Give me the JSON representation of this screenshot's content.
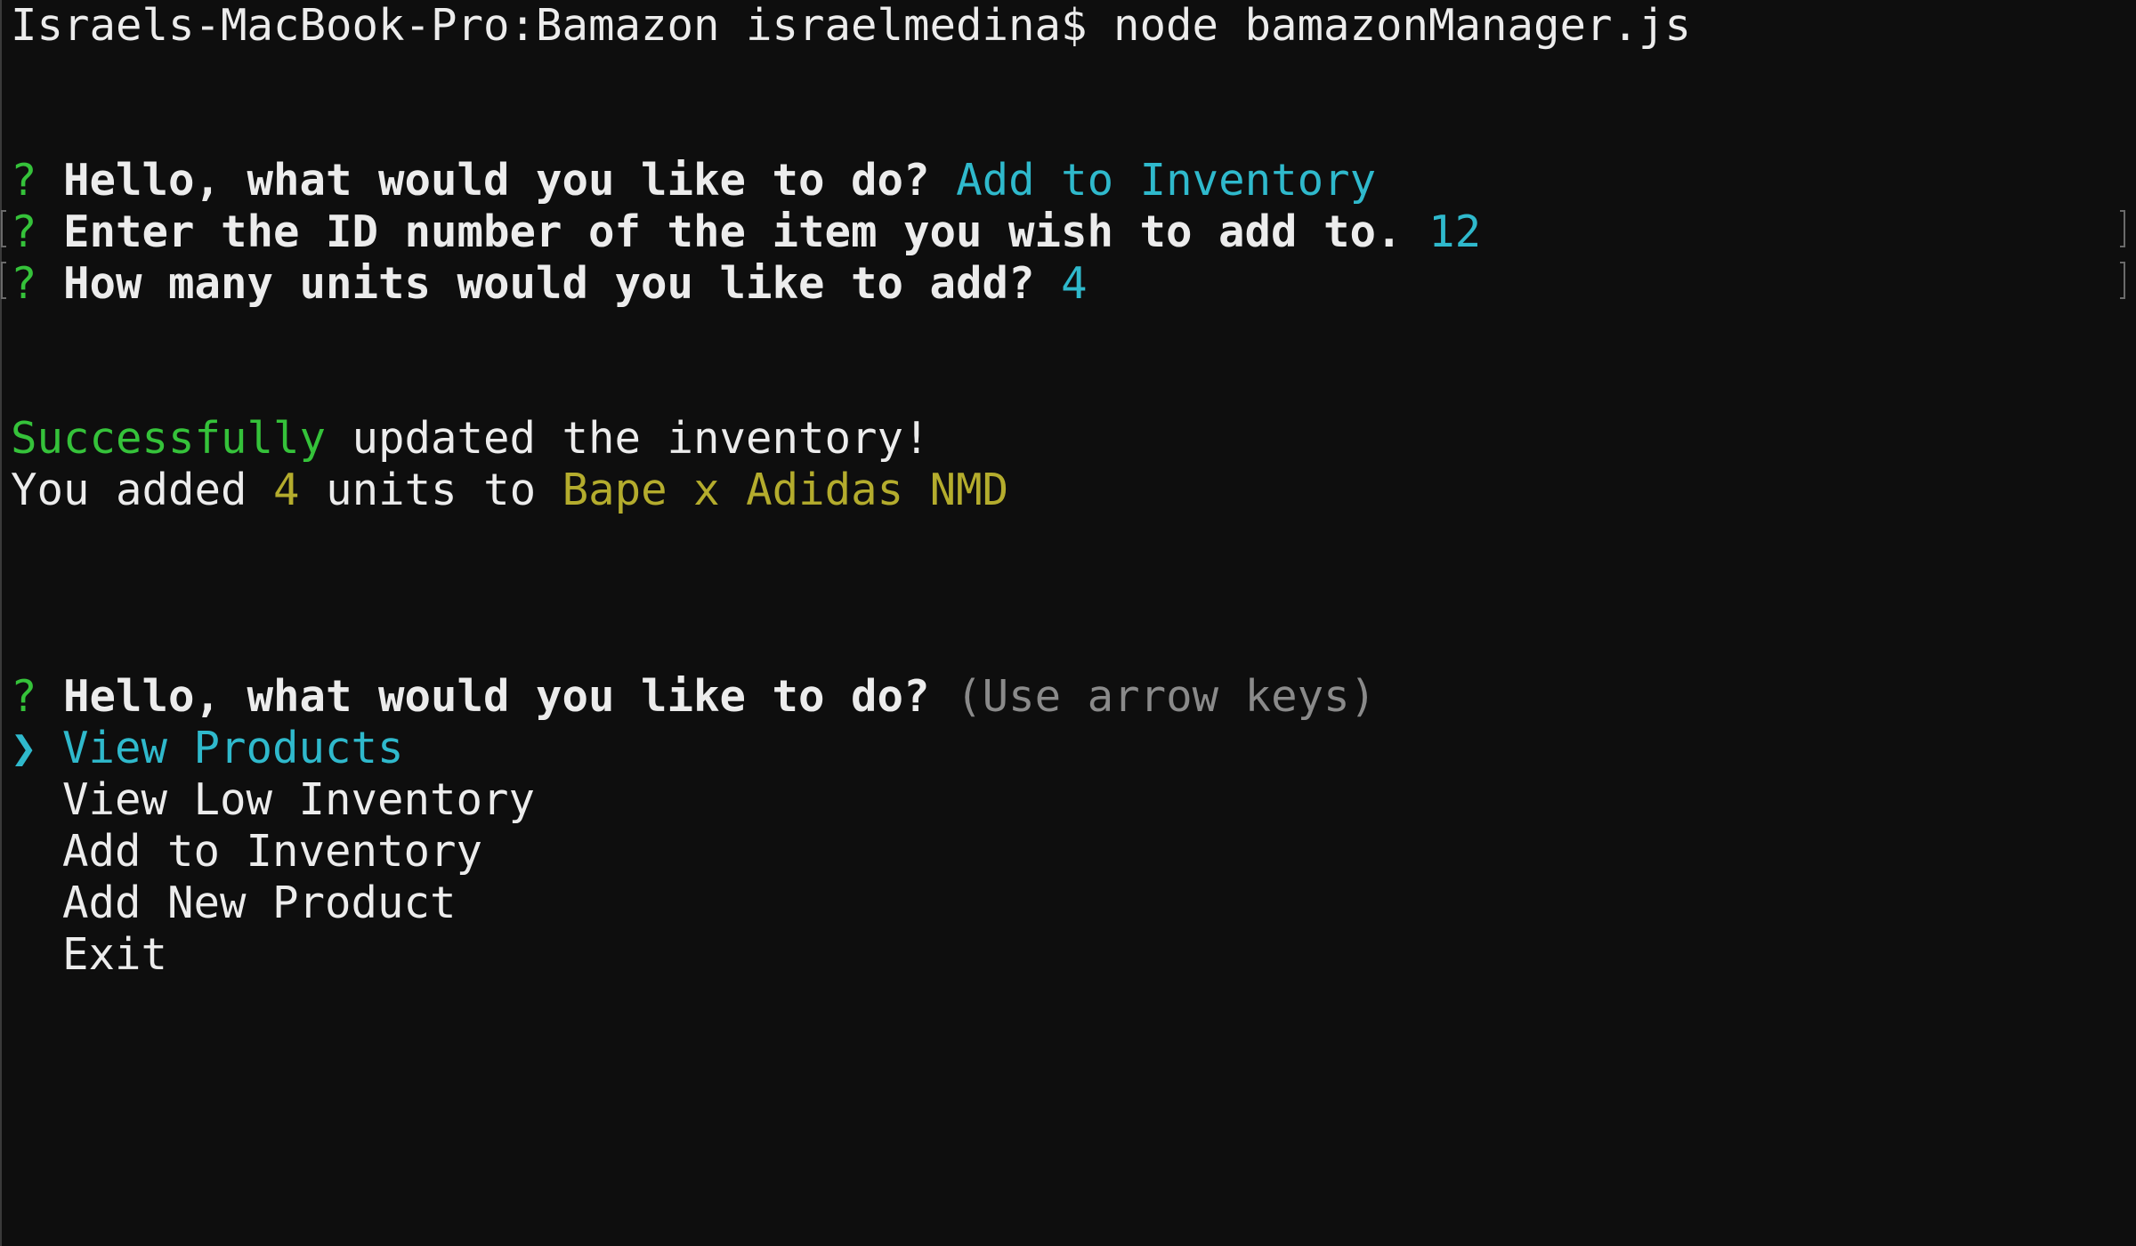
{
  "colors": {
    "background": "#0e0e0e",
    "text": "#ececec",
    "green": "#35c23a",
    "cyan": "#2fb9cc",
    "yellow": "#b4ac2d",
    "gray": "#8a8a8a"
  },
  "terminal": {
    "command_prompt": "Israels-MacBook-Pro:Bamazon israelmedina$",
    "command": "node bamazonManager.js",
    "q1_mark": "?",
    "q1_text": "Hello, what would you like to do?",
    "q1_answer": "Add to Inventory",
    "q2_mark": "?",
    "q2_text": "Enter the ID number of the item you wish to add to.",
    "q2_answer": "12",
    "q3_mark": "?",
    "q3_text": "How many units would you like to add?",
    "q3_answer": "4",
    "success_word": "Successfully",
    "success_rest": "updated the inventory!",
    "added_prefix": "You added",
    "added_count": "4",
    "added_mid": "units to",
    "added_product": "Bape x Adidas NMD",
    "q4_mark": "?",
    "q4_text": "Hello, what would you like to do?",
    "q4_hint": "(Use arrow keys)",
    "pointer": "❯",
    "menu": {
      "items": [
        {
          "label": "View Products",
          "selected": true
        },
        {
          "label": "View Low Inventory",
          "selected": false
        },
        {
          "label": "Add to Inventory",
          "selected": false
        },
        {
          "label": "Add New Product",
          "selected": false
        },
        {
          "label": "Exit",
          "selected": false
        }
      ]
    }
  }
}
